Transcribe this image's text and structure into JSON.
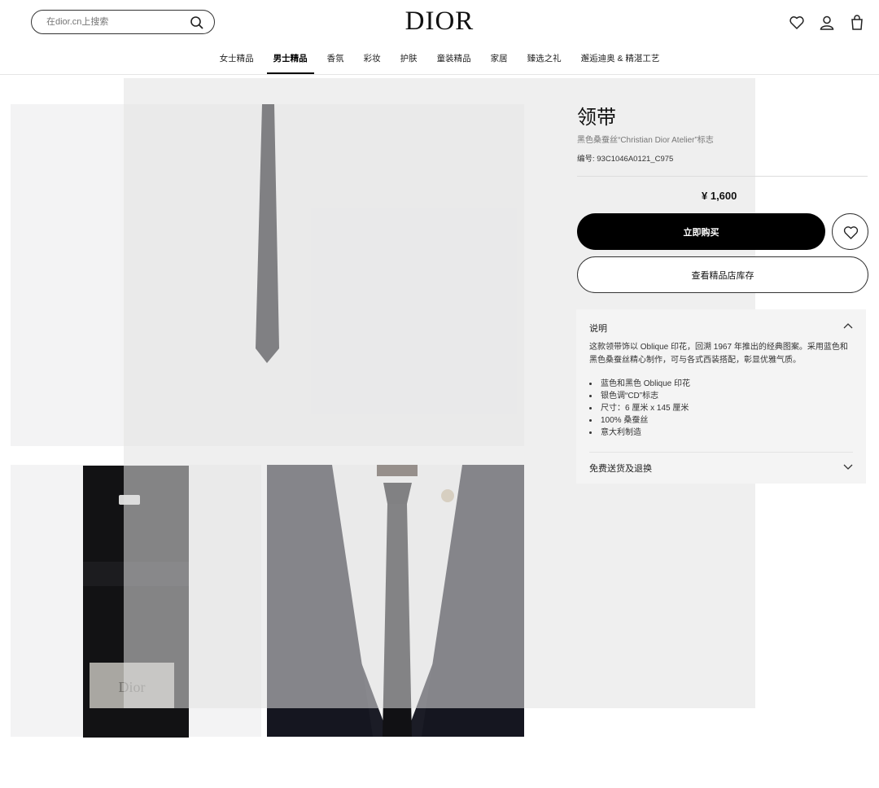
{
  "header": {
    "search_placeholder": "在dior.cn上搜索",
    "logo": "DIOR",
    "icons": [
      "heart-icon",
      "user-icon",
      "bag-icon"
    ]
  },
  "nav": [
    "女士精品",
    "男士精品",
    "香氛",
    "彩妆",
    "护肤",
    "童装精品",
    "家居",
    "臻选之礼",
    "邂逅迪奥 & 精湛工艺"
  ],
  "nav_active": "男士精品",
  "product": {
    "title": "领带",
    "subtitle": "黑色桑蚕丝“Christian Dior Atelier”标志",
    "ref": "编号: 93C1046A0121_C975",
    "price": "¥ 1,600",
    "buy_label": "立即购买",
    "stock_label": "查看精品店库存"
  },
  "description": {
    "heading": "说明",
    "text": "这款领带饰以 Oblique 印花，回溯 1967 年推出的经典图案。采用蓝色和黑色桑蚕丝精心制作，可与各式西装搭配，彰显优雅气质。",
    "bullets": [
      "蓝色和黑色 Oblique 印花",
      "银色调“CD”标志",
      "尺寸：6 厘米 x 145 厘米",
      "100% 桑蚕丝",
      "意大利制造"
    ],
    "shipping": "免费送货及退换"
  },
  "plate_text": "Dior",
  "colors": {
    "accent": "#000000",
    "panel": "#f4f4f4"
  }
}
